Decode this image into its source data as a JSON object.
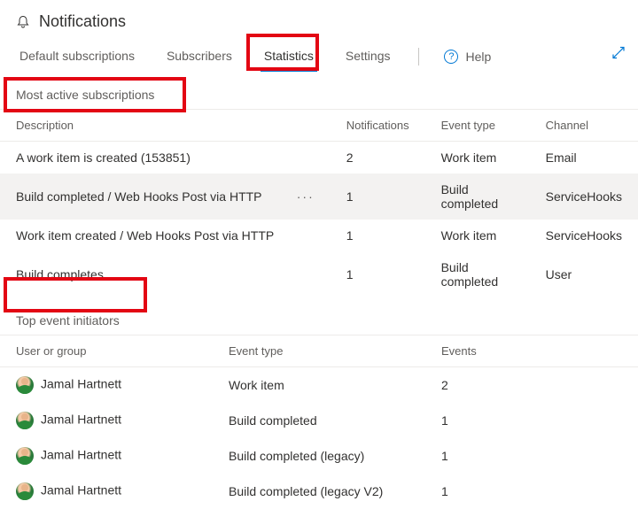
{
  "header": {
    "title": "Notifications"
  },
  "tabs": {
    "items": [
      {
        "label": "Default subscriptions"
      },
      {
        "label": "Subscribers"
      },
      {
        "label": "Statistics"
      },
      {
        "label": "Settings"
      }
    ],
    "help_label": "Help"
  },
  "sections": {
    "active": {
      "heading": "Most active subscriptions",
      "columns": {
        "description": "Description",
        "notifications": "Notifications",
        "event_type": "Event type",
        "channel": "Channel"
      },
      "rows": [
        {
          "description": "A work item is created (153851)",
          "notifications": "2",
          "event_type": "Work item",
          "channel": "Email",
          "more": false
        },
        {
          "description": "Build completed / Web Hooks Post via HTTP",
          "notifications": "1",
          "event_type": "Build completed",
          "channel": "ServiceHooks",
          "more": true
        },
        {
          "description": "Work item created / Web Hooks Post via HTTP",
          "notifications": "1",
          "event_type": "Work item",
          "channel": "ServiceHooks",
          "more": false
        },
        {
          "description": "Build completes",
          "notifications": "1",
          "event_type": "Build completed",
          "channel": "User",
          "more": false
        }
      ]
    },
    "initiators": {
      "heading": "Top event initiators",
      "columns": {
        "user": "User or group",
        "event_type": "Event type",
        "events": "Events"
      },
      "rows": [
        {
          "user": "Jamal Hartnett",
          "event_type": "Work item",
          "events": "2"
        },
        {
          "user": "Jamal Hartnett",
          "event_type": "Build completed",
          "events": "1"
        },
        {
          "user": "Jamal Hartnett",
          "event_type": "Build completed (legacy)",
          "events": "1"
        },
        {
          "user": "Jamal Hartnett",
          "event_type": "Build completed (legacy V2)",
          "events": "1"
        }
      ]
    }
  }
}
